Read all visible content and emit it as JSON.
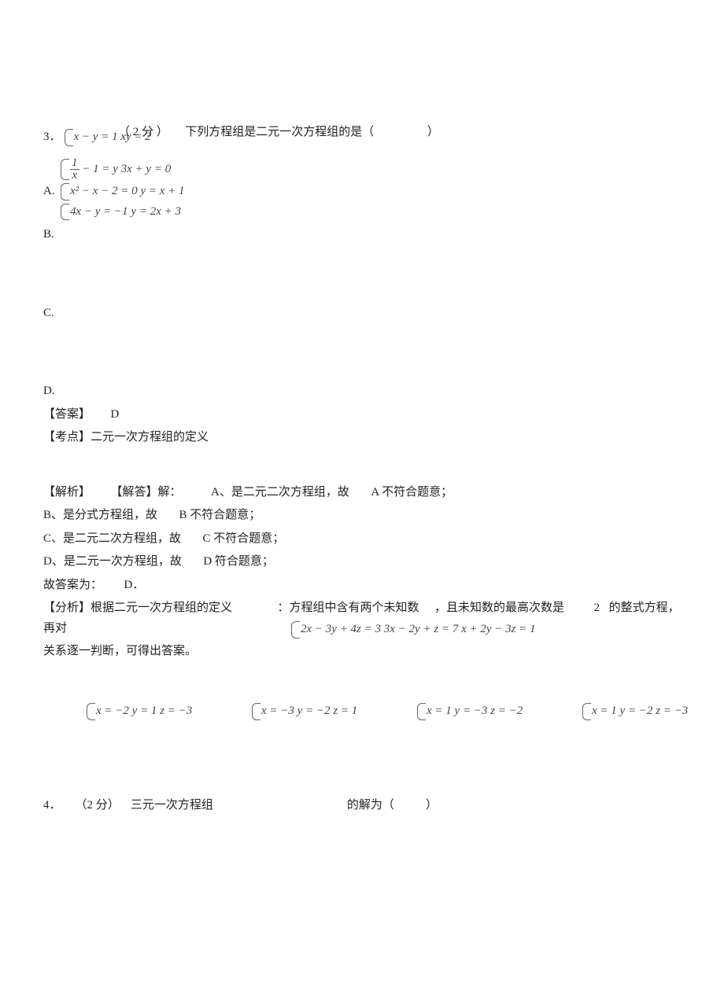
{
  "q3": {
    "number": "3．",
    "points_open": "（",
    "points": "2 分",
    "points_close": "）",
    "stem": "下列方程组是二元一次方程组的是（",
    "stem_close": "）",
    "top_eq": {
      "r1": "x − y = 1",
      "r2": "xy = 2"
    },
    "optA": {
      "label": "A.",
      "eq1": {
        "r1_frac_num": "1",
        "r1_frac_den": "x",
        "r1_rest": " − 1 = y",
        "r2": "3x + y = 0"
      },
      "eq2": {
        "r1": "x² − x − 2 = 0",
        "r2": "y = x + 1"
      },
      "eq3": {
        "r1": "4x − y = −1",
        "r2": "y = 2x + 3"
      }
    },
    "optB": {
      "label": "B."
    },
    "optC": {
      "label": "C."
    },
    "optD": {
      "label": "D."
    },
    "answer_label": "【答案】",
    "answer_value": "D",
    "kaodian_label": "【考点】",
    "kaodian_value": "二元一次方程组的定义",
    "jiexi_label": "【解析】",
    "jieda_label": "【解答】解：",
    "lineA_pre": "A、是二元二次方程组，故",
    "lineA_post": "A 不符合题意；",
    "lineB_pre": "B、是分式方程组，故",
    "lineB_post": "B 不符合题意；",
    "lineC_pre": "C、是二元二次方程组，故",
    "lineC_post": "C 不符合题意；",
    "lineD_pre": "D、是二元一次方程组，故",
    "lineD_post": "D 符合题意；",
    "hence_pre": "故答案为：",
    "hence_val": "D．",
    "fenxi_label": "【分析】",
    "fenxi_1": "根据二元一次方程组的定义",
    "fenxi_2": "：方程组中含有两个未知数",
    "fenxi_3": "，且未知数的最高次数是",
    "fenxi_4": "2",
    "fenxi_5": "的整式方程，再对",
    "fenxi_6": "关系逐一判断，可得出答案。"
  },
  "overlay": {
    "sys": {
      "r1": "2x − 3y + 4z = 3",
      "r2": "3x − 2y + z = 7",
      "r3": "x + 2y − 3z = 1"
    },
    "g1": {
      "r1": "x = −2",
      "r2": "y = 1",
      "r3": "z = −3"
    },
    "g2": {
      "r1": "x = −3",
      "r2": "y = −2",
      "r3": "z = 1"
    },
    "g3": {
      "r1": "x = 1",
      "r2": "y = −3",
      "r3": "z = −2"
    },
    "g4": {
      "r1": "x = 1",
      "r2": "y = −2",
      "r3": "z = −3"
    }
  },
  "q4": {
    "number": "4．",
    "points_open": "（",
    "points": "2 分",
    "points_close": "）",
    "stem1": "三元一次方程组",
    "stem2": "的解为（",
    "stem3": "）"
  }
}
